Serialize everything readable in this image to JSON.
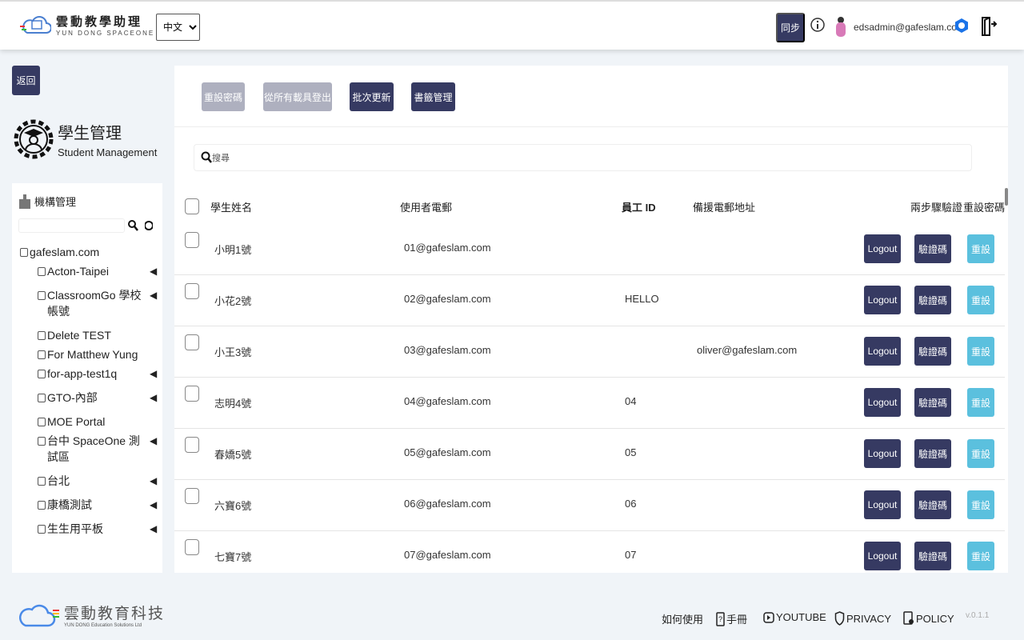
{
  "header": {
    "logo_cn": "雲動教學助理",
    "logo_en": "YUN DONG SPACEONE",
    "language": "中文",
    "sync_label": "同步",
    "user_email": "edsadmin@gafeslam.com"
  },
  "page": {
    "back_label": "返回",
    "title": "學生管理",
    "subtitle": "Student Management"
  },
  "sidebar": {
    "heading": "機構管理",
    "search_value": "",
    "root": "gafeslam.com",
    "items": [
      {
        "label": "Acton-Taipei",
        "expandable": true
      },
      {
        "label": "ClassroomGo 學校帳號",
        "expandable": true
      },
      {
        "label": "Delete TEST",
        "expandable": false
      },
      {
        "label": "For Matthew Yung",
        "expandable": false
      },
      {
        "label": "for-app-test1q",
        "expandable": true
      },
      {
        "label": "GTO-內部",
        "expandable": true
      },
      {
        "label": "MOE Portal",
        "expandable": false
      },
      {
        "label": "台中 SpaceOne 測試區",
        "expandable": true
      },
      {
        "label": "台北",
        "expandable": true
      },
      {
        "label": "康橋測試",
        "expandable": true
      },
      {
        "label": "生生用平板",
        "expandable": true
      }
    ]
  },
  "toolbar": {
    "reset_password": "重設密碼",
    "logout_all": "從所有載具登出",
    "batch_update": "批次更新",
    "bookmark_manage": "書籤管理"
  },
  "search": {
    "placeholder": "搜尋"
  },
  "table": {
    "columns": [
      "學生姓名",
      "使用者電郵",
      "員工 ID",
      "備援電郵地址",
      "兩步驟驗證",
      "重設密碼"
    ],
    "logout_label": "Logout",
    "verify_label": "驗證碼",
    "reset_label": "重設",
    "rows": [
      {
        "name": "小明1號",
        "email": "01@gafeslam.com",
        "id": "",
        "backup": ""
      },
      {
        "name": "小花2號",
        "email": "02@gafeslam.com",
        "id": "HELLO",
        "backup": ""
      },
      {
        "name": "小王3號",
        "email": "03@gafeslam.com",
        "id": "",
        "backup": "oliver@gafeslam.com"
      },
      {
        "name": "志明4號",
        "email": "04@gafeslam.com",
        "id": "04",
        "backup": ""
      },
      {
        "name": "春嬌5號",
        "email": "05@gafeslam.com",
        "id": "05",
        "backup": ""
      },
      {
        "name": "六寶6號",
        "email": "06@gafeslam.com",
        "id": "06",
        "backup": ""
      },
      {
        "name": "七寶7號",
        "email": "07@gafeslam.com",
        "id": "07",
        "backup": ""
      }
    ]
  },
  "footer": {
    "brand_cn": "雲動教育科技",
    "brand_en": "YUN DONG Education Solutions Ltd",
    "how_to": "如何使用",
    "manual": "手冊",
    "youtube": "YOUTUBE",
    "privacy": "PRIVACY",
    "policy": "POLICY",
    "version": "v.0.1.1"
  },
  "colors": {
    "primary": "#363a62",
    "disabled": "#aeb0bf",
    "reset": "#5bc0de",
    "background": "#f0f4f8"
  }
}
